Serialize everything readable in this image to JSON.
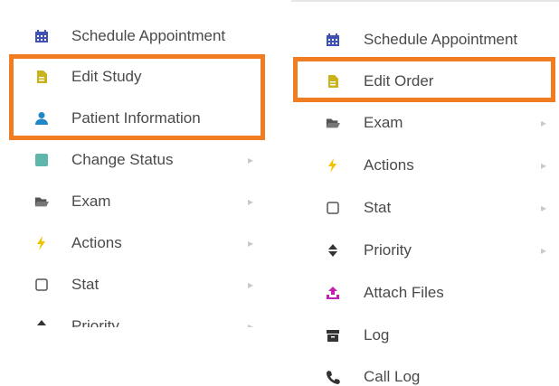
{
  "colors": {
    "highlight": "#f07d22",
    "label": "#4a4a4a",
    "calendar": "#3f51b5",
    "edit": "#c9b21b",
    "user": "#1f87c6",
    "status": "#5fb7ac",
    "folder": "#555555",
    "bolt": "#f2c200",
    "upload": "#c51fb8",
    "dark": "#333333"
  },
  "left_menu": {
    "items": [
      {
        "label": "Schedule Appointment",
        "icon": "calendar-icon",
        "has_submenu": false
      },
      {
        "label": "Edit Study",
        "icon": "edit-document-icon",
        "has_submenu": false
      },
      {
        "label": "Patient Information",
        "icon": "user-icon",
        "has_submenu": false
      },
      {
        "label": "Change Status",
        "icon": "status-square-icon",
        "has_submenu": true
      },
      {
        "label": "Exam",
        "icon": "folder-open-icon",
        "has_submenu": true
      },
      {
        "label": "Actions",
        "icon": "bolt-icon",
        "has_submenu": true
      },
      {
        "label": "Stat",
        "icon": "checkbox-icon",
        "has_submenu": true
      },
      {
        "label": "Priority",
        "icon": "sort-icon",
        "has_submenu": true
      }
    ],
    "chevron": "▸"
  },
  "right_menu": {
    "items": [
      {
        "label": "Schedule Appointment",
        "icon": "calendar-icon",
        "has_submenu": false
      },
      {
        "label": "Edit Order",
        "icon": "edit-document-icon",
        "has_submenu": false
      },
      {
        "label": "Exam",
        "icon": "folder-open-icon",
        "has_submenu": true
      },
      {
        "label": "Actions",
        "icon": "bolt-icon",
        "has_submenu": true
      },
      {
        "label": "Stat",
        "icon": "checkbox-icon",
        "has_submenu": true
      },
      {
        "label": "Priority",
        "icon": "sort-icon",
        "has_submenu": true
      },
      {
        "label": "Attach Files",
        "icon": "upload-icon",
        "has_submenu": false
      },
      {
        "label": "Log",
        "icon": "archive-icon",
        "has_submenu": false
      },
      {
        "label": "Call Log",
        "icon": "phone-icon",
        "has_submenu": false
      }
    ],
    "chevron": "▸"
  }
}
